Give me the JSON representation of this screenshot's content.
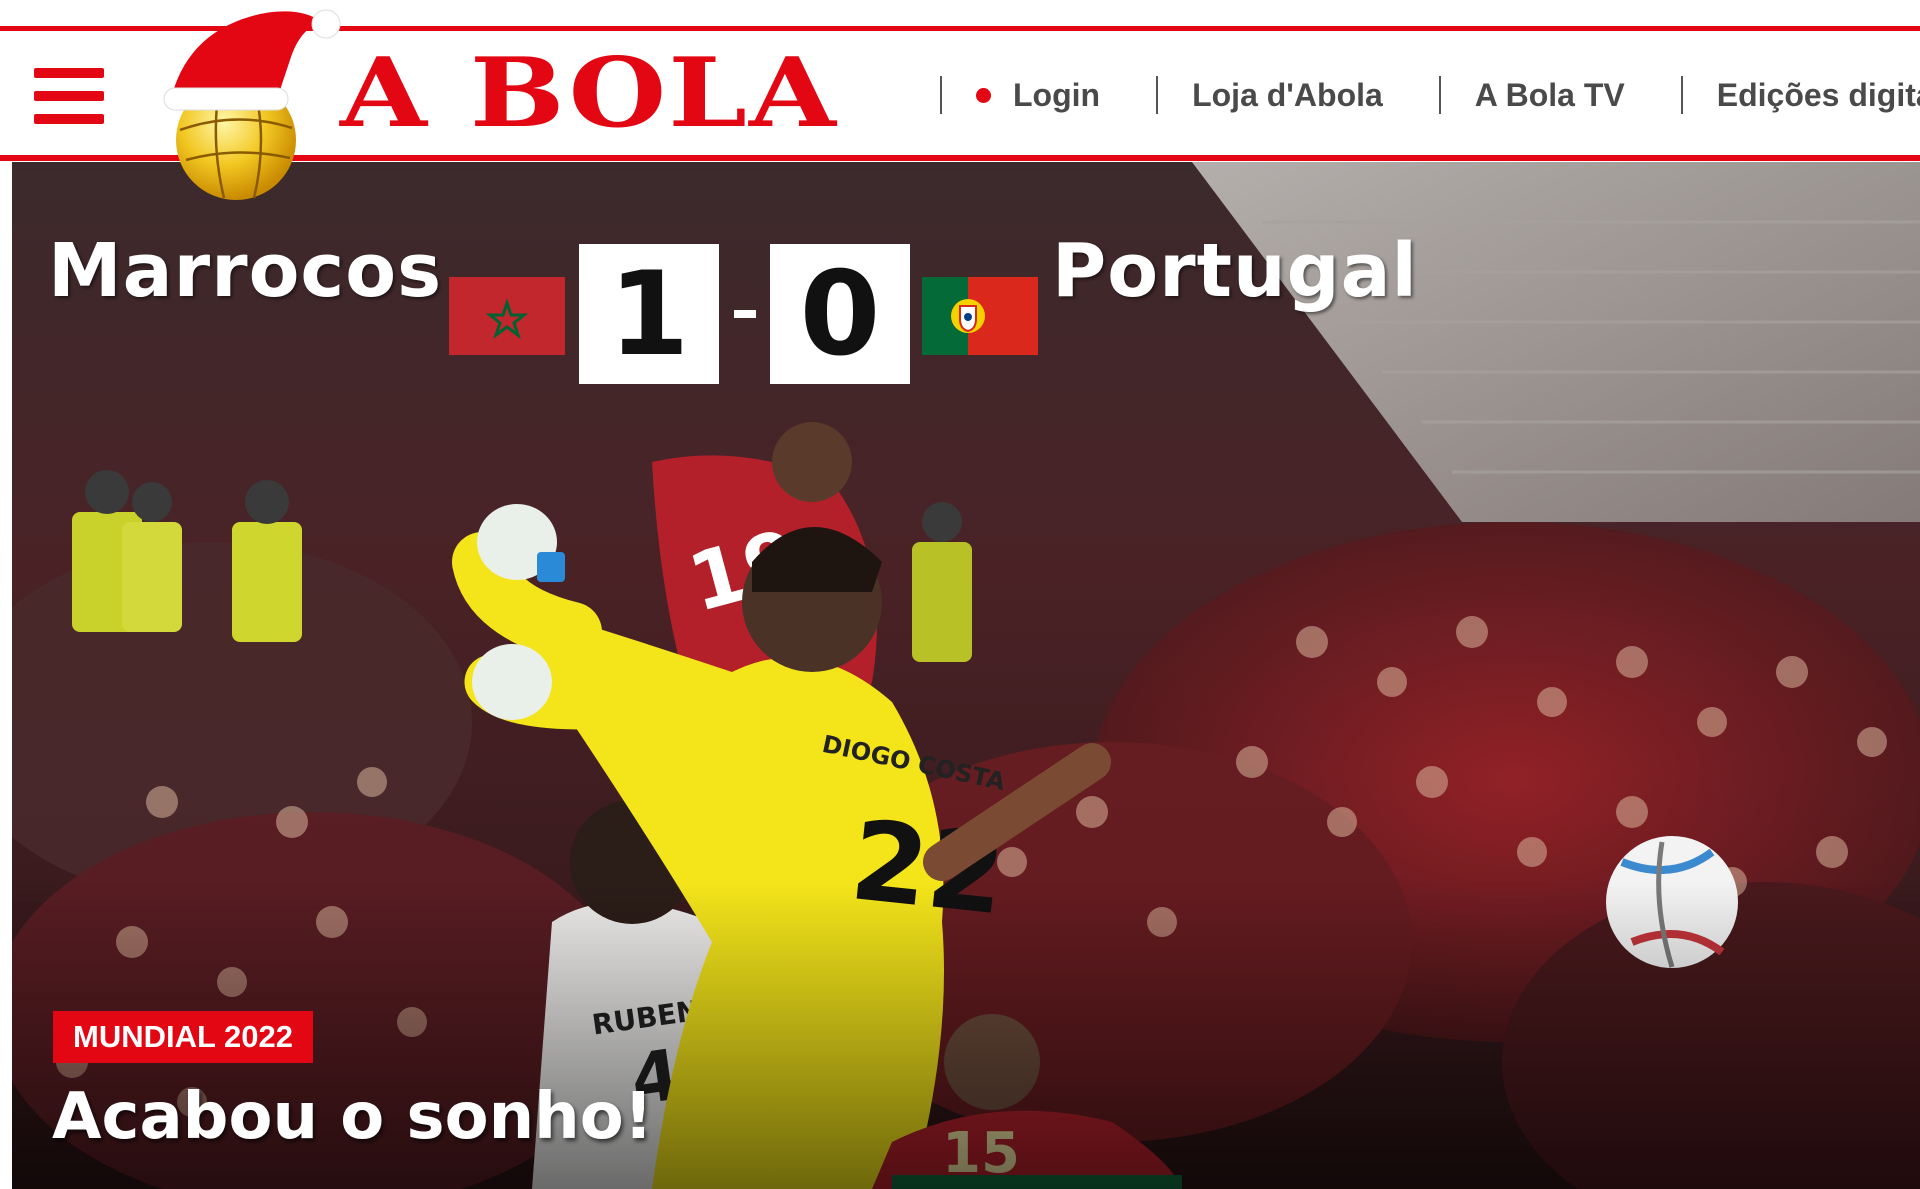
{
  "header": {
    "logo_text": "A BOLA",
    "menu_icon": "hamburger-menu-icon",
    "nav": [
      {
        "label": "Login",
        "icon": "red-dot-icon"
      },
      {
        "label": "Loja d'Abola"
      },
      {
        "label": "A Bola TV"
      },
      {
        "label": "Edições digita"
      }
    ]
  },
  "hero": {
    "home_team": "Marrocos",
    "away_team": "Portugal",
    "home_score": "1",
    "away_score": "0",
    "home_flag_icon": "morocco-flag-icon",
    "away_flag_icon": "portugal-flag-icon",
    "tag": "MUNDIAL 2022",
    "headline": "Acabou o sonho!"
  },
  "colors": {
    "brand_red": "#e30613",
    "nav_text": "#4a4a4a",
    "keeper_yellow": "#f4e51a",
    "morocco_red": "#c1272d",
    "morocco_green": "#006233",
    "portugal_green": "#046a38",
    "portugal_red": "#da291c"
  }
}
